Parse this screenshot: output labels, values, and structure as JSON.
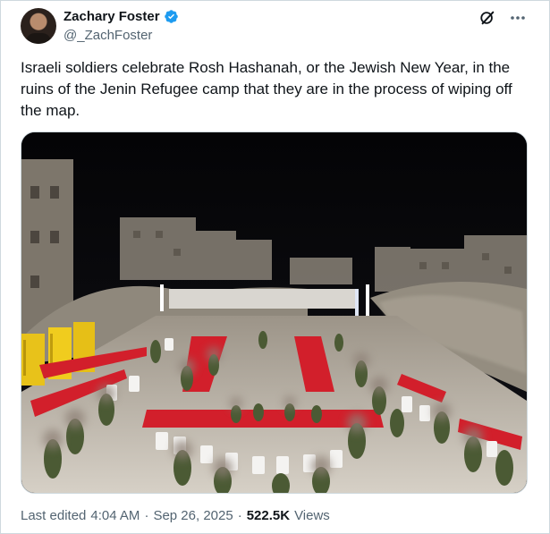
{
  "author": {
    "display_name": "Zachary Foster",
    "handle": "@_ZachFoster",
    "verified": true
  },
  "icons": {
    "grok": "grok-icon",
    "more": "more-icon",
    "verified": "verified-badge-icon"
  },
  "tweet": {
    "text": "Israeli soldiers celebrate Rosh Hashanah, or the Jewish New Year, in the ruins of the Jenin Refugee camp that they are in the process of wiping off the map."
  },
  "meta": {
    "last_edited_label": "Last edited",
    "time": "4:04 AM",
    "separator": "·",
    "date": "Sep 26, 2025",
    "separator2": "·",
    "views_count": "522.5K",
    "views_label": "Views"
  },
  "colors": {
    "verified_blue": "#1d9bf0",
    "secondary_text": "#536471",
    "tablecloth_red": "#d21f2b",
    "uniform_olive": "#4b5a34"
  }
}
